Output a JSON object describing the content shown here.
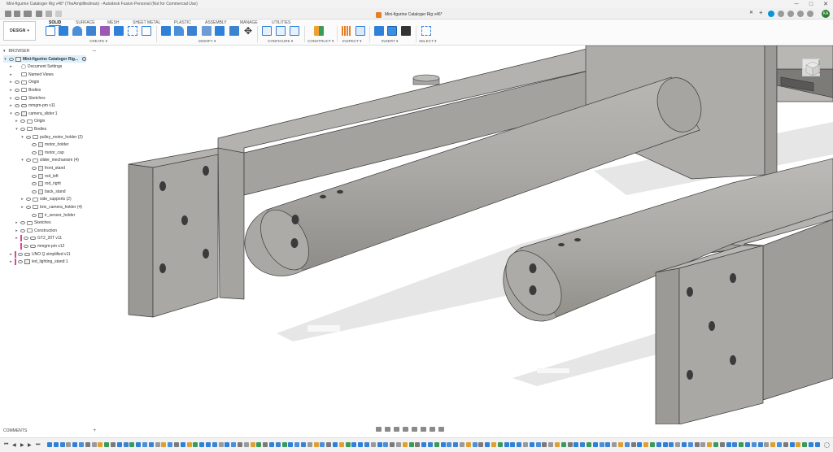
{
  "titlebar": {
    "title": "Mini-figurine Cataloger Rig v46* (TheAmplifiedman) - Autodesk Fusion Personal (Not for Commercial Use)",
    "minimize": "─",
    "maximize": "□",
    "close": "✕"
  },
  "document_tab": {
    "label": "Mini-figurine Cataloger Rig v46*",
    "close": "✕",
    "add": "+",
    "avatar": "KA"
  },
  "ribbon": {
    "workspace": "DESIGN",
    "workspace_caret": "▾",
    "tabs": [
      "SOLID",
      "SURFACE",
      "MESH",
      "SHEET METAL",
      "PLASTIC",
      "ASSEMBLY",
      "MANAGE",
      "UTILITIES"
    ],
    "active_tab": "SOLID",
    "groups": [
      "CREATE ▾",
      "MODIFY ▾",
      "CONFIGURE ▾",
      "CONSTRUCT ▾",
      "INSPECT ▾",
      "INSERT ▾",
      "SELECT ▾"
    ]
  },
  "browser": {
    "title": "BROWSER",
    "collapse": "─",
    "items": [
      {
        "label": "Mini-figurine Cataloger Rig...",
        "indent": 0,
        "arrow": "▾",
        "icon": "document-icon",
        "selected": true,
        "eye": true
      },
      {
        "label": "Document Settings",
        "indent": 1,
        "arrow": "▸",
        "icon": "gear-icon",
        "eye": false
      },
      {
        "label": "Named Views",
        "indent": 1,
        "arrow": "▸",
        "icon": "folder-icon",
        "eye": false
      },
      {
        "label": "Origin",
        "indent": 1,
        "arrow": "▸",
        "icon": "folder-icon",
        "eye": true
      },
      {
        "label": "Bodies",
        "indent": 1,
        "arrow": "▸",
        "icon": "folder-icon",
        "eye": true
      },
      {
        "label": "Sketches",
        "indent": 1,
        "arrow": "▸",
        "icon": "folder-icon",
        "eye": true
      },
      {
        "label": "mmgm-pm v11",
        "indent": 1,
        "arrow": "▸",
        "icon": "link-icon",
        "eye": true
      },
      {
        "label": "camera_slider:1",
        "indent": 1,
        "arrow": "▾",
        "icon": "component-icon",
        "eye": true
      },
      {
        "label": "Origin",
        "indent": 2,
        "arrow": "▸",
        "icon": "folder-icon",
        "eye": true
      },
      {
        "label": "Bodies",
        "indent": 2,
        "arrow": "▾",
        "icon": "folder-icon",
        "eye": true
      },
      {
        "label": "pulley_motor_holder (2)",
        "indent": 3,
        "arrow": "▾",
        "icon": "folder-icon",
        "eye": true
      },
      {
        "label": "motor_holder",
        "indent": 4,
        "arrow": "",
        "icon": "body-icon",
        "eye": true
      },
      {
        "label": "motor_cap",
        "indent": 4,
        "arrow": "",
        "icon": "body-icon",
        "eye": true
      },
      {
        "label": "slider_mechanism (4)",
        "indent": 3,
        "arrow": "▾",
        "icon": "folder-icon",
        "eye": true
      },
      {
        "label": "front_stand",
        "indent": 4,
        "arrow": "",
        "icon": "body-icon",
        "eye": true
      },
      {
        "label": "rod_left",
        "indent": 4,
        "arrow": "",
        "icon": "body-icon",
        "eye": true
      },
      {
        "label": "rod_right",
        "indent": 4,
        "arrow": "",
        "icon": "body-icon",
        "eye": true
      },
      {
        "label": "back_stand",
        "indent": 4,
        "arrow": "",
        "icon": "body-icon",
        "eye": true
      },
      {
        "label": "side_supports (2)",
        "indent": 3,
        "arrow": "▸",
        "icon": "folder-icon",
        "eye": true
      },
      {
        "label": "brio_camera_holder (4)",
        "indent": 3,
        "arrow": "▸",
        "icon": "folder-icon",
        "eye": true
      },
      {
        "label": "ir_sensor_holder",
        "indent": 4,
        "arrow": "",
        "icon": "body-icon",
        "eye": true
      },
      {
        "label": "Sketches",
        "indent": 2,
        "arrow": "▸",
        "icon": "folder-icon",
        "eye": true
      },
      {
        "label": "Construction",
        "indent": 2,
        "arrow": "▸",
        "icon": "folder-icon",
        "eye": true
      },
      {
        "label": "GT2_20T v11",
        "indent": 2,
        "arrow": "▸",
        "icon": "link-icon",
        "eye": true,
        "bar": "#e040a0"
      },
      {
        "label": "mmgm-pm v12",
        "indent": 2,
        "arrow": "",
        "icon": "link-icon",
        "eye": true,
        "bar": "#e040a0"
      },
      {
        "label": "UNO Q simplified v11",
        "indent": 1,
        "arrow": "▸",
        "icon": "link-icon",
        "eye": true,
        "bar": "#e040a0"
      },
      {
        "label": "led_lighting_stand:1",
        "indent": 1,
        "arrow": "▸",
        "icon": "component-icon",
        "eye": true,
        "bar": "#e040a0"
      }
    ]
  },
  "comments": {
    "label": "COMMENTS",
    "add": "+"
  },
  "colors": {
    "accent": "#0696d7",
    "part_face": "#a9a7a3",
    "part_dark": "#8f8d89",
    "part_light": "#bcbab6",
    "edge": "#3a3a3a",
    "highlight_bar": "#e040a0"
  }
}
